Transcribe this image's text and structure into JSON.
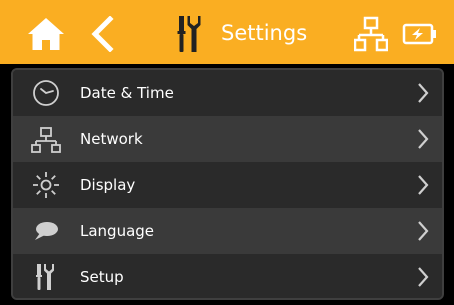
{
  "header": {
    "title": "Settings",
    "background_color": "#FAAE22",
    "icons": [
      "home-icon",
      "back-arrow-icon",
      "tools-icon",
      "network-icon",
      "battery-charging-icon"
    ]
  },
  "menu": {
    "items": [
      {
        "label": "Date & Time",
        "icon": "clock-icon"
      },
      {
        "label": "Network",
        "icon": "network-icon"
      },
      {
        "label": "Display",
        "icon": "brightness-icon"
      },
      {
        "label": "Language",
        "icon": "speech-bubble-icon"
      },
      {
        "label": "Setup",
        "icon": "tools-icon"
      }
    ]
  }
}
